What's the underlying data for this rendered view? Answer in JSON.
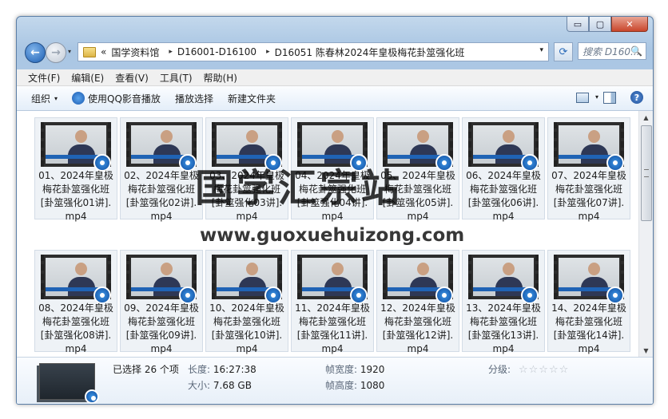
{
  "window": {
    "min": "▭",
    "max": "▢",
    "close": "✕"
  },
  "address": {
    "hist": "▾",
    "prefix": "«",
    "segments": [
      "国学资料馆",
      "D16001-D16100",
      "D16051 陈春林2024年皇极梅花卦筮强化班"
    ],
    "sep": "▸",
    "drop": "▾"
  },
  "search": {
    "placeholder": "搜索 D160...",
    "icon": "🔍"
  },
  "nav": {
    "back": "←",
    "forward": "→",
    "refresh": "⟳"
  },
  "menu": [
    "文件(F)",
    "编辑(E)",
    "查看(V)",
    "工具(T)",
    "帮助(H)"
  ],
  "toolbar": {
    "organize": "组织",
    "play_qq": "使用QQ影音播放",
    "play_select": "播放选择",
    "new_folder": "新建文件夹",
    "dd": "▾",
    "view_dd": "▾",
    "help": "?"
  },
  "files": [
    "01、2024年皇极梅花卦筮强化班[卦筮强化01讲].mp4",
    "02、2024年皇极梅花卦筮强化班[卦筮强化02讲].mp4",
    "03、2024年皇极梅花卦筮强化班[卦筮强化03讲].mp4",
    "04、2024年皇极梅花卦筮强化班[卦筮强化04讲].mp4",
    "05、2024年皇极梅花卦筮强化班[卦筮强化05讲].mp4",
    "06、2024年皇极梅花卦筮强化班[卦筮强化06讲].mp4",
    "07、2024年皇极梅花卦筮强化班[卦筮强化07讲].mp4",
    "08、2024年皇极梅花卦筮强化班[卦筮强化08讲].mp4",
    "09、2024年皇极梅花卦筮强化班[卦筮强化09讲].mp4",
    "10、2024年皇极梅花卦筮强化班[卦筮强化10讲].mp4",
    "11、2024年皇极梅花卦筮强化班[卦筮强化11讲].mp4",
    "12、2024年皇极梅花卦筮强化班[卦筮强化12讲].mp4",
    "13、2024年皇极梅花卦筮强化班[卦筮强化13讲].mp4",
    "14、2024年皇极梅花卦筮强化班[卦筮强化14讲].mp4"
  ],
  "scroll": {
    "up": "▲",
    "down": "▼"
  },
  "details": {
    "selected": "已选择 26 个项",
    "length_label": "长度:",
    "length": "16:27:38",
    "size_label": "大小:",
    "size": "7.68 GB",
    "width_label": "帧宽度:",
    "width": "1920",
    "height_label": "帧高度:",
    "height": "1080",
    "rating_label": "分级:",
    "stars": "☆☆☆☆☆"
  },
  "watermark": {
    "text": "国学汇宗站",
    "url": "www.guoxuehuizong.com"
  }
}
